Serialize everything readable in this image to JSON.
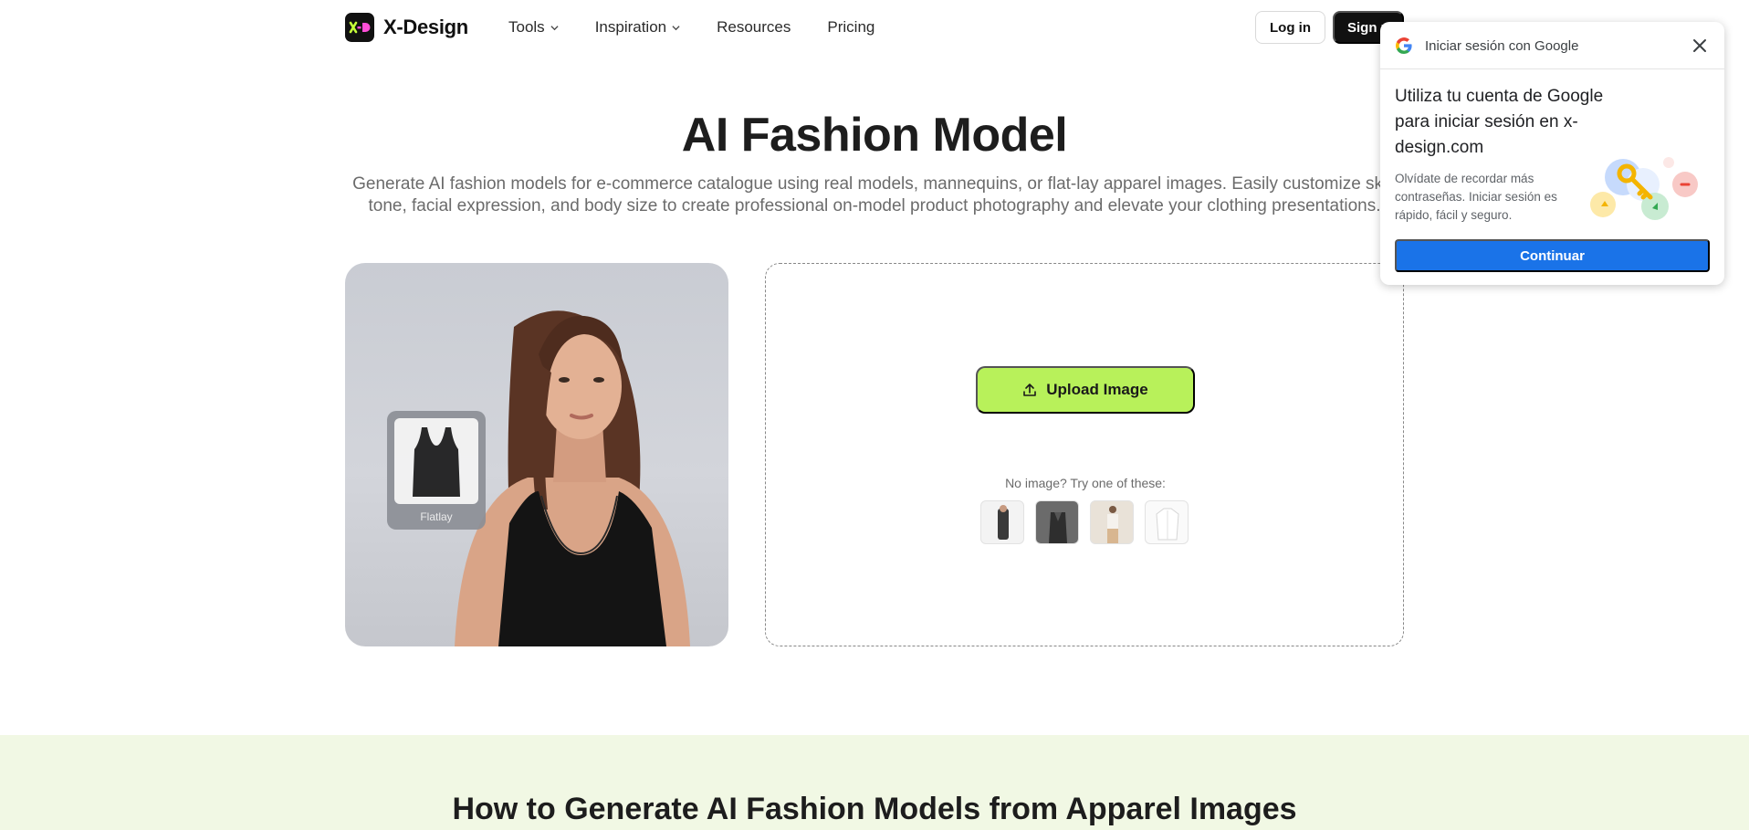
{
  "header": {
    "brand": "X-Design",
    "nav": [
      {
        "label": "Tools",
        "has_dropdown": true
      },
      {
        "label": "Inspiration",
        "has_dropdown": true
      },
      {
        "label": "Resources",
        "has_dropdown": false
      },
      {
        "label": "Pricing",
        "has_dropdown": false
      }
    ],
    "login_label": "Log in",
    "signup_label": "Sign up"
  },
  "hero": {
    "title": "AI Fashion Model",
    "subtitle": "Generate AI fashion models for e-commerce catalogue using real models, mannequins, or flat-lay apparel images. Easily customize skin tone, facial expression, and body size to create professional on-model product photography and elevate your clothing presentations."
  },
  "preview": {
    "flat_label": "Flatlay"
  },
  "upload": {
    "button_label": "Upload Image",
    "try_text": "No image? Try one of these:",
    "samples": [
      "sample-outfit-dark",
      "sample-suit-grey",
      "sample-beige-outfit",
      "sample-white-shirt"
    ]
  },
  "how": {
    "title": "How to Generate AI Fashion Models from Apparel Images"
  },
  "google_popup": {
    "header": "Iniciar sesión con Google",
    "heading": "Utiliza tu cuenta de Google para iniciar sesión en x-design.com",
    "body": "Olvídate de recordar más contraseñas. Iniciar sesión es rápido, fácil y seguro.",
    "continue_label": "Continuar"
  },
  "colors": {
    "accent_green": "#b8f15a",
    "google_blue": "#1a73e8",
    "section_bg": "#f1f8e4"
  }
}
